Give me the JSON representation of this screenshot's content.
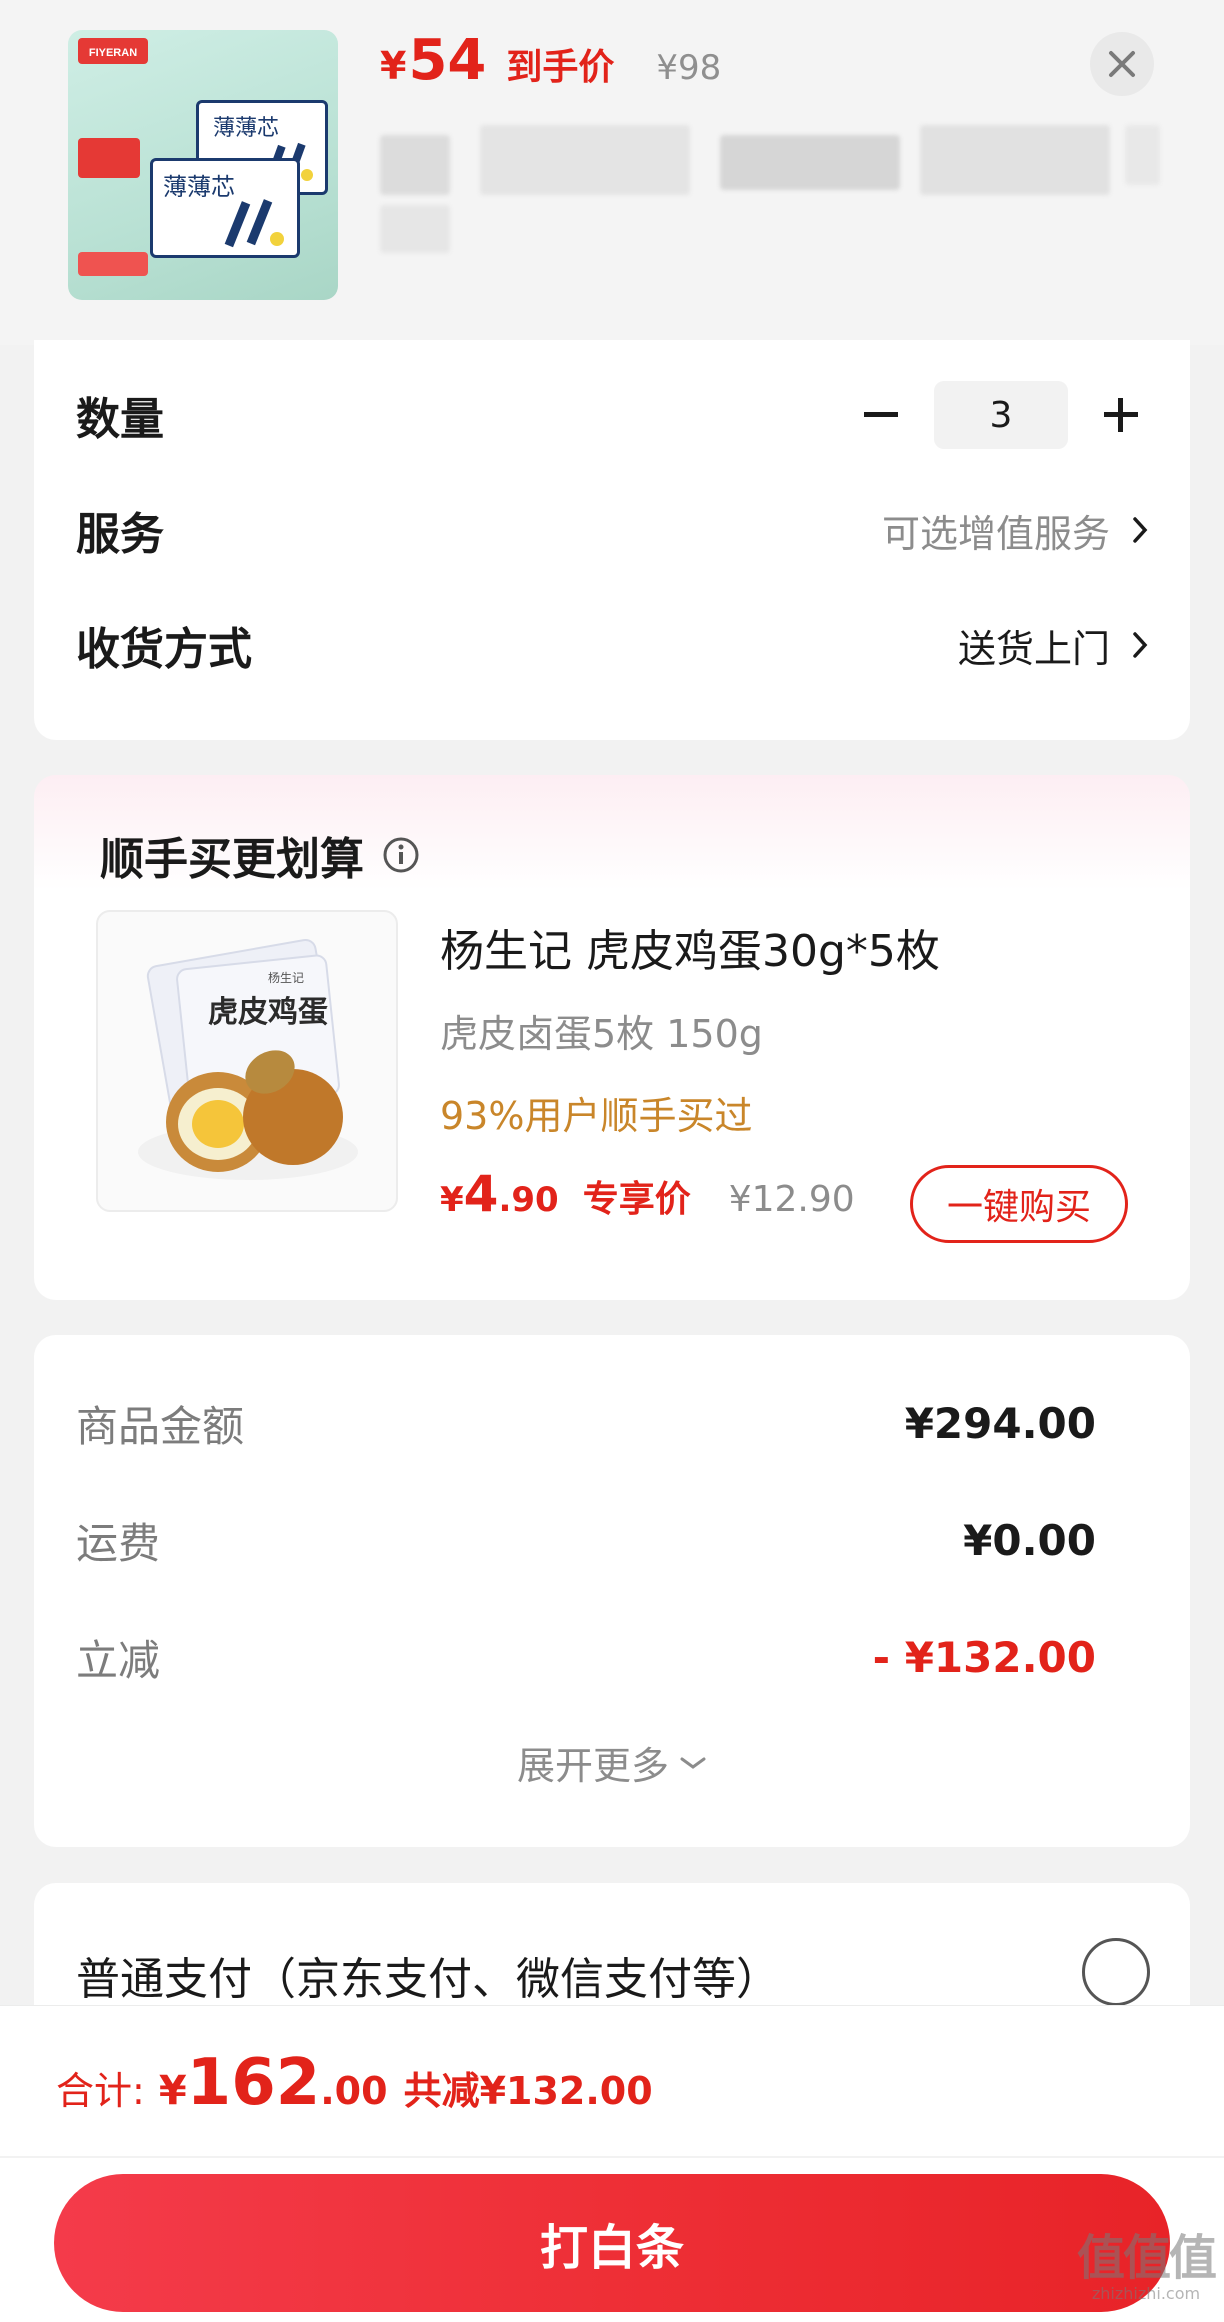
{
  "header": {
    "price_currency": "¥",
    "price_value": "54",
    "price_label": "到手价",
    "original_price": "¥98",
    "product_image_logo": "FIYERAN",
    "product_image_text": "薄薄芯"
  },
  "options": {
    "quantity_label": "数量",
    "quantity_value": "3",
    "service_label": "服务",
    "service_value": "可选增值服务",
    "delivery_label": "收货方式",
    "delivery_value": "送货上门"
  },
  "addon": {
    "section_title": "顺手买更划算",
    "product_name": "杨生记 虎皮鸡蛋30g*5枚",
    "product_sub": "虎皮卤蛋5枚 150g",
    "social_proof": "93%用户顺手买过",
    "price_currency": "¥",
    "price_int": "4",
    "price_dec": ".90",
    "price_label": "专享价",
    "original_price": "¥12.90",
    "buy_button": "一键购买",
    "image_text": "虎皮鸡蛋",
    "image_brand": "杨生记"
  },
  "amounts": {
    "rows": [
      {
        "label": "商品金额",
        "value": "¥294.00"
      },
      {
        "label": "运费",
        "value": "¥0.00"
      },
      {
        "label": "立减",
        "value": "- ¥132.00"
      }
    ],
    "expand_label": "展开更多"
  },
  "payment": {
    "method_label": "普通支付（京东支付、微信支付等）"
  },
  "footer": {
    "total_label": "合计:",
    "total_currency": "¥",
    "total_int": "162",
    "total_dec": ".00",
    "total_saved": "共减¥132.00",
    "pay_button": "打白条"
  },
  "watermark": {
    "big": "值值值",
    "small": "zhizhizhi.com"
  },
  "colors": {
    "accent_red": "#e2231a",
    "social_gold": "#c9862a",
    "muted_gray": "#8c8c8c"
  }
}
